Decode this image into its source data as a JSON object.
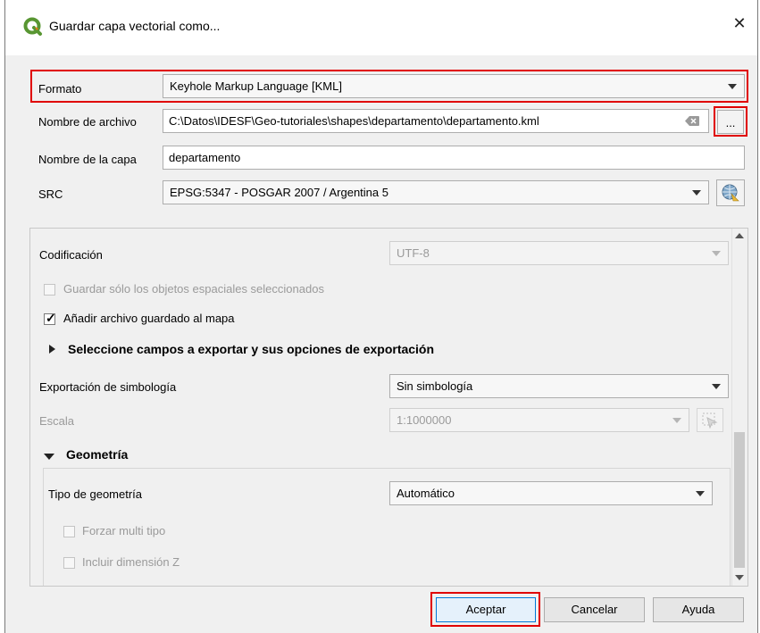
{
  "dialog": {
    "title": "Guardar capa vectorial como...",
    "close_glyph": "✕"
  },
  "form": {
    "format_label": "Formato",
    "format_value": "Keyhole Markup Language [KML]",
    "filename_label": "Nombre de archivo",
    "filename_value": "C:\\Datos\\IDESF\\Geo-tutoriales\\shapes\\departamento\\departamento.kml",
    "browse_label": "...",
    "layername_label": "Nombre de la capa",
    "layername_value": "departamento",
    "crs_label": "SRC",
    "crs_value": "EPSG:5347 - POSGAR 2007 / Argentina 5"
  },
  "options": {
    "encoding_label": "Codificación",
    "encoding_value": "UTF-8",
    "selected_only_label": "Guardar sólo los objetos espaciales seleccionados",
    "add_to_map_label": "Añadir archivo guardado al mapa",
    "fields_section_label": "Seleccione campos a exportar y sus opciones de exportación",
    "symbology_label": "Exportación de simbología",
    "symbology_value": "Sin simbología",
    "scale_label": "Escala",
    "scale_value": "1:1000000",
    "geometry_section_label": "Geometría",
    "geometry_type_label": "Tipo de geometría",
    "geometry_type_value": "Automático",
    "force_multi_label": "Forzar multi tipo",
    "include_z_label": "Incluir dimensión Z"
  },
  "buttons": {
    "ok": "Aceptar",
    "cancel": "Cancelar",
    "help": "Ayuda"
  },
  "colors": {
    "highlight": "#e00000",
    "qgis_green": "#589632"
  }
}
